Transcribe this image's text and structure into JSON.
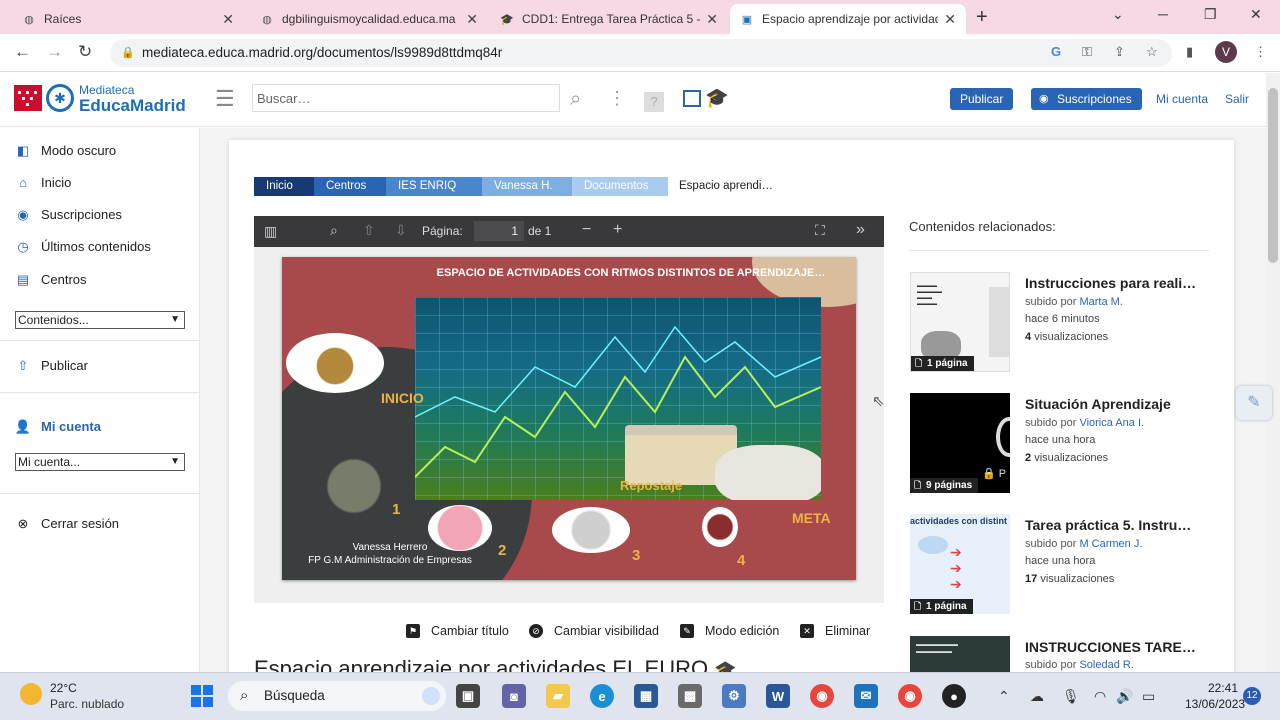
{
  "browser": {
    "tabs": [
      {
        "title": "Raíces",
        "icon": "globe-icon"
      },
      {
        "title": "dgbilinguismoycalidad.educa.ma",
        "icon": "globe-icon"
      },
      {
        "title": "CDD1: Entrega Tarea Práctica 5 -",
        "icon": "mortarboard-icon"
      },
      {
        "title": "Espacio aprendizaje por actividad",
        "icon": "mediateca-icon"
      }
    ],
    "url": "mediateca.educa.madrid.org/documentos/ls9989d8ttdmq84r",
    "profile_initial": "V"
  },
  "header": {
    "logo_top": "Mediateca",
    "logo_main": "EducaMadrid",
    "search_placeholder": "Buscar…",
    "publish_label": "Publicar",
    "subscriptions_label": "Suscripciones",
    "account_link": "Mi cuenta",
    "exit_link": "Salir"
  },
  "sidebar": {
    "items": [
      {
        "label": "Modo oscuro",
        "icon": "dark-mode-icon"
      },
      {
        "label": "Inicio",
        "icon": "home-icon"
      },
      {
        "label": "Suscripciones",
        "icon": "rss-icon"
      },
      {
        "label": "Últimos contenidos",
        "icon": "clock-icon"
      },
      {
        "label": "Centros",
        "icon": "building-icon"
      }
    ],
    "contents_select": "Contenidos...",
    "publish": "Publicar",
    "account_heading": "Mi cuenta",
    "account_select": "Mi cuenta...",
    "logout": "Cerrar sesión"
  },
  "breadcrumb": [
    "Inicio",
    "Centros",
    "IES ENRIQ",
    "Vanessa H.",
    "Documentos",
    "Espacio aprendi…"
  ],
  "viewer": {
    "page_label": "Página:",
    "page_current": "1",
    "page_total": "de 1"
  },
  "slide": {
    "title": "ESPACIO DE ACTIVIDADES CON RITMOS DISTINTOS DE APRENDIZAJE…",
    "label_inicio": "INICIO",
    "label_repostaje": "Repostaje",
    "label_meta": "META",
    "num1": "1",
    "num2": "2",
    "num3": "3",
    "num4": "4",
    "credit_name": "Vanessa Herrero",
    "credit_course": "FP G.M Administración de Empresas"
  },
  "actions": {
    "change_title": "Cambiar título",
    "change_visibility": "Cambiar visibilidad",
    "edit_mode": "Modo edición",
    "delete": "Eliminar"
  },
  "page_title": "Espacio aprendizaje por actividades EL EURO",
  "related": {
    "heading": "Contenidos relacionados:",
    "uploaded_by": "subido por",
    "views_suffix": "visualizaciones",
    "items": [
      {
        "title": "Instrucciones para reali…",
        "author": "Marta M.",
        "time": "hace 6 minutos",
        "views": "4",
        "pages": "1 página"
      },
      {
        "title": "Situación Aprendizaje",
        "author": "Viorica Ana I.",
        "time": "hace una hora",
        "views": "2",
        "pages": "9 páginas"
      },
      {
        "title": "Tarea práctica 5. Instru…",
        "author": "M Carmen J.",
        "time": "hace una hora",
        "views": "17",
        "pages": "1 página"
      },
      {
        "title": "INSTRUCCIONES TARE…",
        "author": "Soledad R."
      }
    ]
  },
  "taskbar": {
    "temperature": "22°C",
    "weather": "Parc. nublado",
    "search": "Búsqueda",
    "time": "22:41",
    "date": "13/06/2023",
    "notifications": "12"
  },
  "colors": {
    "brand_blue": "#2a64b5",
    "madrid_red": "#c8102e",
    "slide_bg": "#a84a4b",
    "slide_accent": "#f0b244"
  }
}
